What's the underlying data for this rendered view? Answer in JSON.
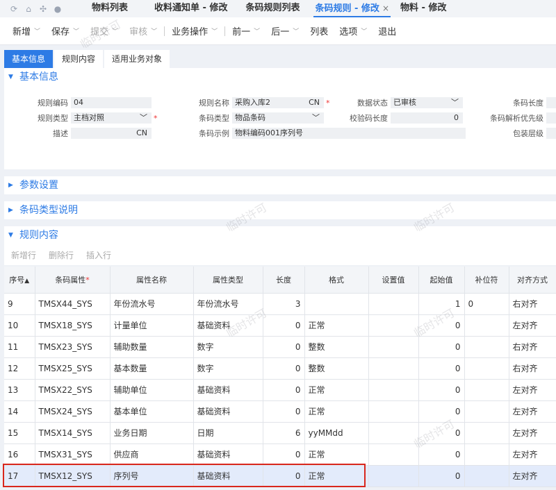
{
  "top_tabs": [
    {
      "label": "物料列表"
    },
    {
      "label": "收料通知单 - 修改"
    },
    {
      "label": "条码规则列表"
    },
    {
      "label": "条码规则 - 修改",
      "close": "×"
    },
    {
      "label": "物料 - 修改"
    }
  ],
  "toolbar": {
    "new": "新增",
    "save": "保存",
    "submit": "提交",
    "audit": "审核",
    "business": "业务操作",
    "prev": "前一",
    "next": "后一",
    "list": "列表",
    "options": "选项",
    "exit": "退出"
  },
  "page_tabs": [
    "基本信息",
    "规则内容",
    "适用业务对象"
  ],
  "basic": {
    "title": "基本信息",
    "code_label": "规则编码",
    "code_value": "04",
    "name_label": "规则名称",
    "name_value": "采购入库2",
    "name_lang": "CN",
    "status_label": "数据状态",
    "status_value": "已审核",
    "barlen_label": "条码长度",
    "type_label": "规则类型",
    "type_value": "主档对照",
    "bartype_label": "条码类型",
    "bartype_value": "物品条码",
    "checklen_label": "校验码长度",
    "checklen_value": "0",
    "priority_label": "条码解析优先级",
    "desc_label": "描述",
    "desc_lang": "CN",
    "example_label": "条码示例",
    "example_value": "物料编码001序列号",
    "pack_label": "包装层级"
  },
  "sections": {
    "params": "参数设置",
    "bartype_desc": "条码类型说明",
    "rules": "规则内容"
  },
  "rule_toolbar": {
    "add": "新增行",
    "delete": "删除行",
    "insert": "插入行"
  },
  "table": {
    "headers": [
      "序号",
      "条码属性",
      "属性名称",
      "属性类型",
      "长度",
      "格式",
      "设置值",
      "起始值",
      "补位符",
      "对齐方式"
    ],
    "sort_mark": "▲",
    "rows": [
      [
        "9",
        "TMSX44_SYS",
        "年份流水号",
        "年份流水号",
        "3",
        "",
        "",
        "1",
        "0",
        "右对齐"
      ],
      [
        "10",
        "TMSX18_SYS",
        "计量单位",
        "基础资料",
        "0",
        "正常",
        "",
        "0",
        "",
        "左对齐"
      ],
      [
        "11",
        "TMSX23_SYS",
        "辅助数量",
        "数字",
        "0",
        "整数",
        "",
        "0",
        "",
        "右对齐"
      ],
      [
        "12",
        "TMSX25_SYS",
        "基本数量",
        "数字",
        "0",
        "整数",
        "",
        "0",
        "",
        "右对齐"
      ],
      [
        "13",
        "TMSX22_SYS",
        "辅助单位",
        "基础资料",
        "0",
        "正常",
        "",
        "0",
        "",
        "左对齐"
      ],
      [
        "14",
        "TMSX24_SYS",
        "基本单位",
        "基础资料",
        "0",
        "正常",
        "",
        "0",
        "",
        "左对齐"
      ],
      [
        "15",
        "TMSX14_SYS",
        "业务日期",
        "日期",
        "6",
        "yyMMdd",
        "",
        "0",
        "",
        "左对齐"
      ],
      [
        "16",
        "TMSX31_SYS",
        "供应商",
        "基础资料",
        "0",
        "正常",
        "",
        "0",
        "",
        "左对齐"
      ],
      [
        "17",
        "TMSX12_SYS",
        "序列号",
        "基础资料",
        "0",
        "正常",
        "",
        "0",
        "",
        "左对齐"
      ]
    ]
  },
  "watermark": "临时许可"
}
